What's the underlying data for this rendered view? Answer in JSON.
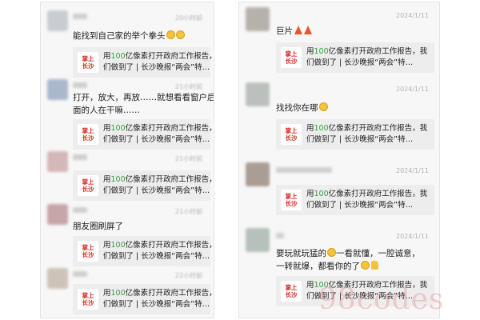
{
  "card": {
    "logo_line1": "掌上",
    "logo_line2": "长沙",
    "title_pre": "用",
    "title_hl": "100",
    "title_post": "亿像素打开政府工作报告，我",
    "title_line2": "们做到了 | 长沙晚报“两会”特…"
  },
  "left_panel": {
    "comments": [
      {
        "time": "20小时前",
        "text": "能找到自己家的举个拳头",
        "emoji": "smile-emoji-icon"
      },
      {
        "time": "21小时前",
        "text_line1": "打开，放大，再放……就想看看窗户后",
        "text_line2": "面的人在干嘛……"
      },
      {
        "time": "21小时前",
        "text": ""
      },
      {
        "time": "21小时前",
        "text": "朋友圈刷屏了"
      },
      {
        "time": "22小时前",
        "text": ""
      }
    ]
  },
  "right_panel": {
    "comments": [
      {
        "name": "巨片",
        "time": "2024/1/11",
        "emoji": "party-popper-icon"
      },
      {
        "time": "2024/1/11",
        "text": "找找你在哪",
        "emoji": "smile-emoji-icon"
      },
      {
        "time": "2024/1/11",
        "text": ""
      },
      {
        "time": "2024/1/11",
        "text_line1": "要玩就玩猛的",
        "text_line1b": "一看就懂，一腔诚意，",
        "text_line2": "一转就爆，都看你的了"
      }
    ]
  },
  "watermark": "98codes",
  "colors": {
    "logo_red": "#d8261f",
    "highlight_green": "#2ea53e",
    "timestamp": "#b4b4b4"
  }
}
